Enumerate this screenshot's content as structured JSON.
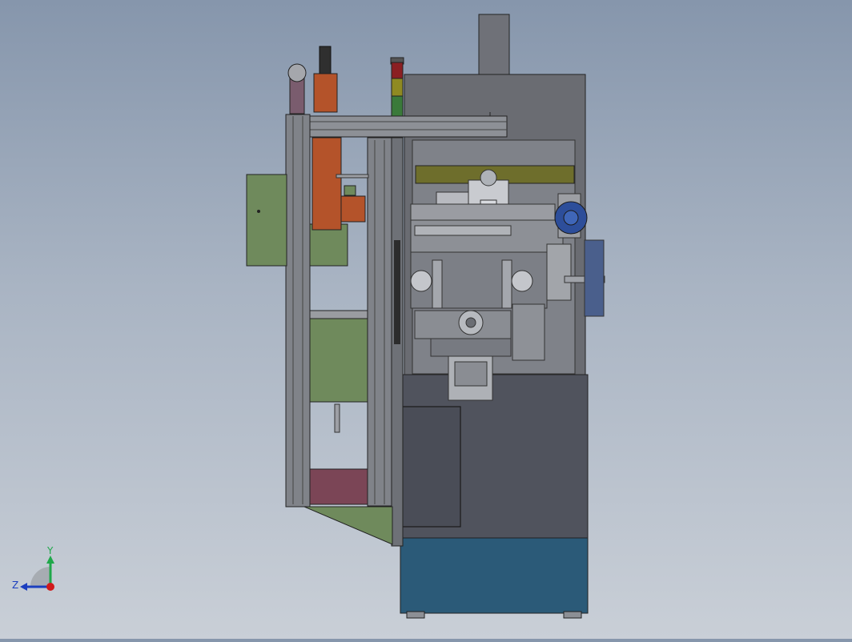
{
  "view": {
    "background_top": "#8696ac",
    "background_bottom": "#c9cfd7"
  },
  "triad": {
    "y_label": "Y",
    "z_label": "Z",
    "y_color": "#1fa84a",
    "z_color": "#1c3fbf",
    "x_color": "#d11a1a"
  },
  "model": {
    "frame_color": "#7d8087",
    "cabinet_color": "#50535d",
    "base_color": "#2b5a78",
    "green_panel_color": "#6f8a5c",
    "orange_color": "#b4532a",
    "motor_color": "#2d4e9a"
  }
}
